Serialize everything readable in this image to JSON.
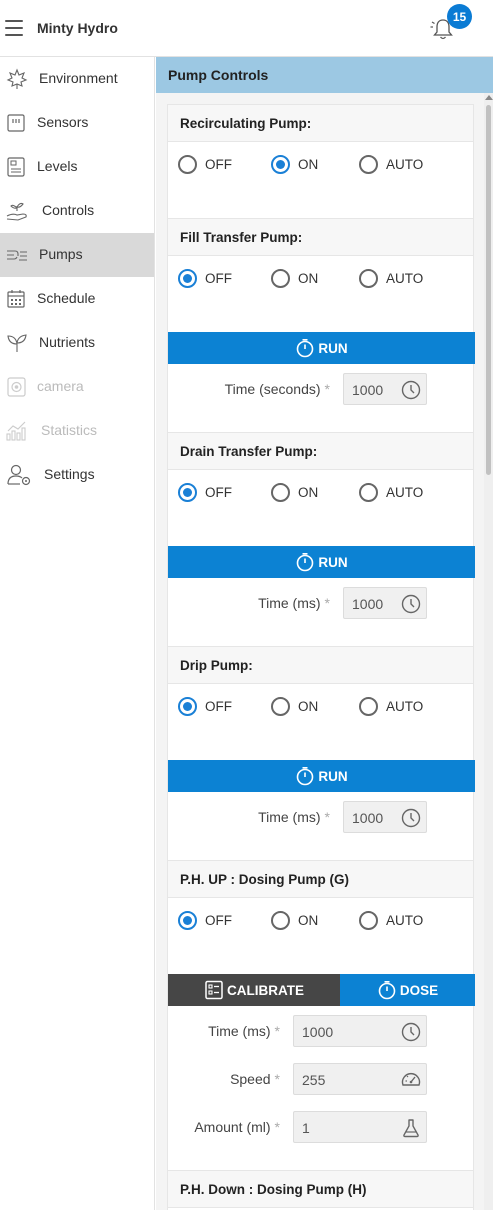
{
  "app": {
    "title": "Minty Hydro",
    "notification_count": "15"
  },
  "sidebar": {
    "items": [
      {
        "label": "Environment",
        "icon": "leaf-icon"
      },
      {
        "label": "Sensors",
        "icon": "sensor-icon"
      },
      {
        "label": "Levels",
        "icon": "levels-icon"
      },
      {
        "label": "Controls",
        "icon": "hand-plant-icon"
      },
      {
        "label": "Pumps",
        "icon": "pump-icon"
      },
      {
        "label": "Schedule",
        "icon": "calendar-icon"
      },
      {
        "label": "Nutrients",
        "icon": "sprout-icon"
      },
      {
        "label": "camera",
        "icon": "camera-icon"
      },
      {
        "label": "Statistics",
        "icon": "chart-icon"
      },
      {
        "label": "Settings",
        "icon": "user-gear-icon"
      }
    ],
    "active": "Pumps"
  },
  "main": {
    "section_title": "Pump Controls",
    "radio_labels": {
      "off": "OFF",
      "on": "ON",
      "auto": "AUTO"
    },
    "run_label": "RUN",
    "calibrate_label": "CALIBRATE",
    "dose_label": "DOSE",
    "required_mark": "*",
    "pumps": {
      "recirculating": {
        "title": "Recirculating Pump:",
        "selected": "ON"
      },
      "fill": {
        "title": "Fill Transfer Pump:",
        "selected": "OFF",
        "time_label": "Time (seconds)",
        "time_value": "1000"
      },
      "drain": {
        "title": "Drain Transfer Pump:",
        "selected": "OFF",
        "time_label": "Time (ms)",
        "time_value": "1000"
      },
      "drip": {
        "title": "Drip Pump:",
        "selected": "OFF",
        "time_label": "Time (ms)",
        "time_value": "1000"
      },
      "ph_up": {
        "title": "P.H. UP : Dosing Pump (G)",
        "selected": "OFF",
        "time_label": "Time (ms)",
        "time_value": "1000",
        "speed_label": "Speed",
        "speed_value": "255",
        "amount_label": "Amount (ml)",
        "amount_value": "1"
      },
      "ph_down": {
        "title": "P.H. Down : Dosing Pump (H)"
      }
    }
  },
  "colors": {
    "accent": "#0c82d3",
    "header_bar": "#9cc8e3",
    "dark_button": "#464646",
    "active_nav": "#d9d9d9"
  }
}
